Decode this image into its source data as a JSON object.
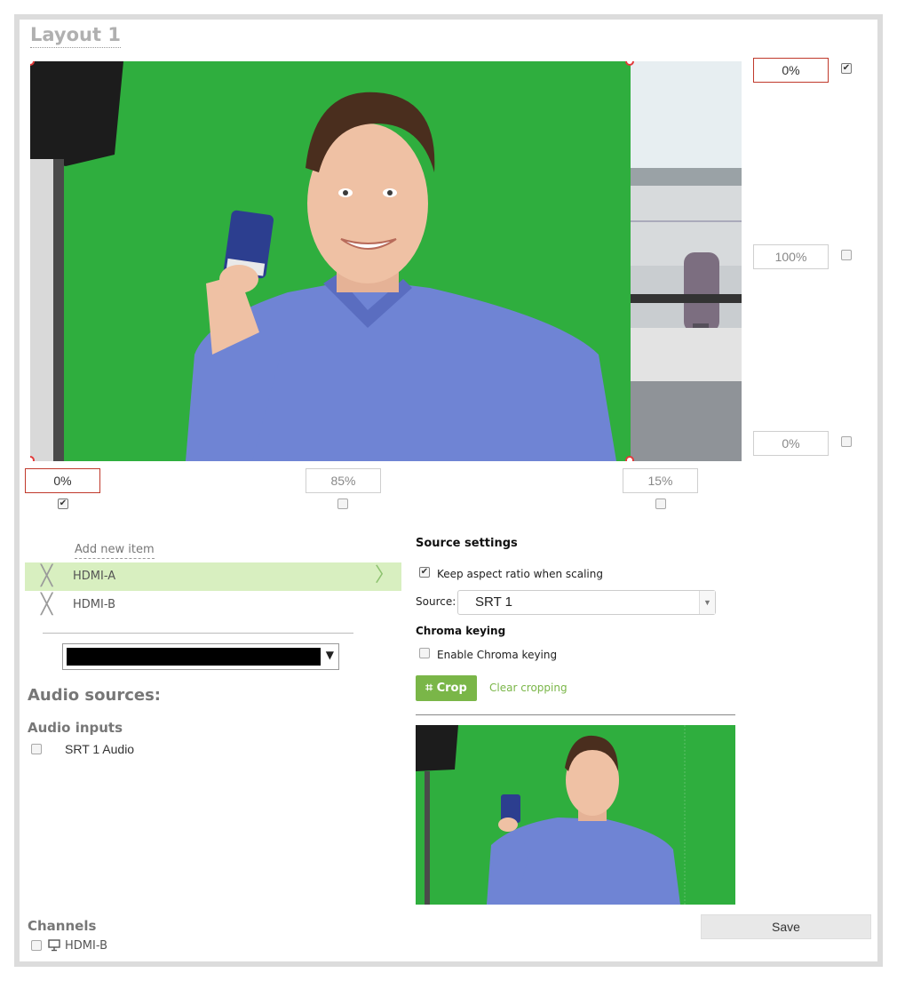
{
  "layout": {
    "title": "Layout 1"
  },
  "canvas": {
    "right_inputs": [
      {
        "value": "0%",
        "checked": true,
        "active": true
      },
      {
        "value": "100%",
        "checked": false,
        "active": false
      },
      {
        "value": "0%",
        "checked": false,
        "active": false
      }
    ],
    "bottom_inputs": [
      {
        "value": "0%",
        "checked": true,
        "active": true
      },
      {
        "value": "85%",
        "checked": false,
        "active": false
      },
      {
        "value": "15%",
        "checked": false,
        "active": false
      }
    ]
  },
  "items": {
    "add_new": "Add new item",
    "list": [
      {
        "label": "HDMI-A",
        "selected": true
      },
      {
        "label": "HDMI-B",
        "selected": false
      }
    ]
  },
  "audio": {
    "heading": "Audio sources:",
    "inputs_heading": "Audio inputs",
    "inputs": [
      {
        "label": "SRT 1 Audio",
        "checked": false
      }
    ]
  },
  "source_settings": {
    "heading": "Source settings",
    "keep_aspect_label": "Keep aspect ratio when scaling",
    "keep_aspect_checked": true,
    "source_label": "Source:",
    "source_value": "SRT 1",
    "chroma_heading": "Chroma keying",
    "chroma_label": "Enable Chroma keying",
    "chroma_checked": false,
    "crop_label": "Crop",
    "clear_label": "Clear cropping"
  },
  "channels": {
    "heading": "Channels",
    "list": [
      {
        "label": "HDMI-B",
        "checked": false
      }
    ]
  },
  "actions": {
    "save_label": "Save"
  },
  "colors": {
    "accent": "#7ab648",
    "selected_row": "#d8efc0",
    "active_border": "#c0392b",
    "chroma_green": "#2fae3e"
  }
}
